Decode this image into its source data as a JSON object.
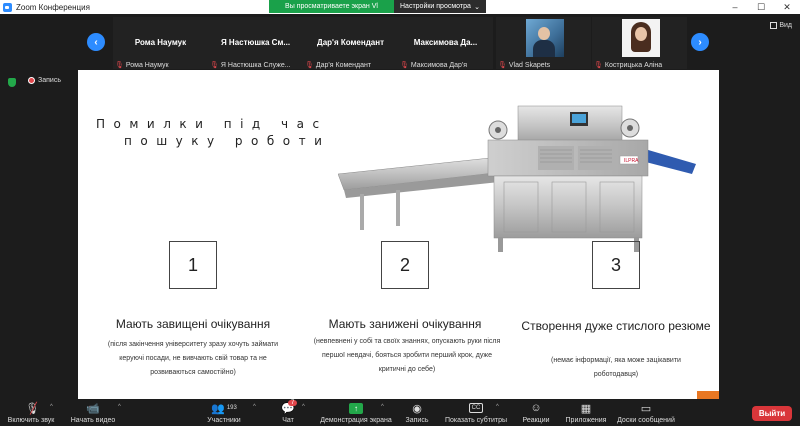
{
  "window": {
    "title": "Zoom Конференция",
    "controls": [
      "–",
      "☐",
      "✕"
    ]
  },
  "share_banner": {
    "status": "Вы просматриваете экран Vl",
    "view_options": "Настройки просмотра",
    "status_color": "#1aa14a"
  },
  "participants": [
    {
      "name": "Рома Наумук",
      "label": "Рома Наумук",
      "video": false
    },
    {
      "name": "Я Настюшка См...",
      "label": "Я Настюшка Служе...",
      "video": false
    },
    {
      "name": "Дар'я Комендант",
      "label": "Дар'я Комендант",
      "video": false
    },
    {
      "name": "Максимова Да...",
      "label": "Максимова Дар'я",
      "video": false
    },
    {
      "name": "",
      "label": "Vlad Skapets",
      "video": true
    },
    {
      "name": "",
      "label": "Кострицька Аліна",
      "video": true
    }
  ],
  "view_toggle": "Вид",
  "recording": "Запись",
  "slide": {
    "title_line1": "Помилки під час",
    "title_line2": "пошуку роботи",
    "brand": "ILPRA",
    "items": [
      {
        "number": "1",
        "heading": "Мають завищені очікування",
        "description": "(після закінчення університету зразу хочуть займати керуючі посади, не вивчають свій товар та не розвиваються самостійно)"
      },
      {
        "number": "2",
        "heading": "Мають занижені очікування",
        "description": "(невпевнені у собі та своїх знаннях, опускають руки після першої невдачі, бояться зробити перший крок, дуже критичні до себе)"
      },
      {
        "number": "3",
        "heading": "Створення дуже стислого резюме",
        "description": "(немає інформації, яка може зацікавити роботодавця)"
      }
    ],
    "accent_color": "#e87722"
  },
  "toolbar": {
    "mute": "Включить звук",
    "video": "Начать видео",
    "participants": "Участники",
    "participants_count": "193",
    "chat": "Чат",
    "chat_badge": "7",
    "share": "Демонстрация экрана",
    "record": "Запись",
    "subtitles": "Показать субтитры",
    "reactions": "Реакции",
    "apps": "Приложения",
    "whiteboard": "Доски сообщений",
    "leave": "Выйти",
    "leave_color": "#d9363a"
  }
}
